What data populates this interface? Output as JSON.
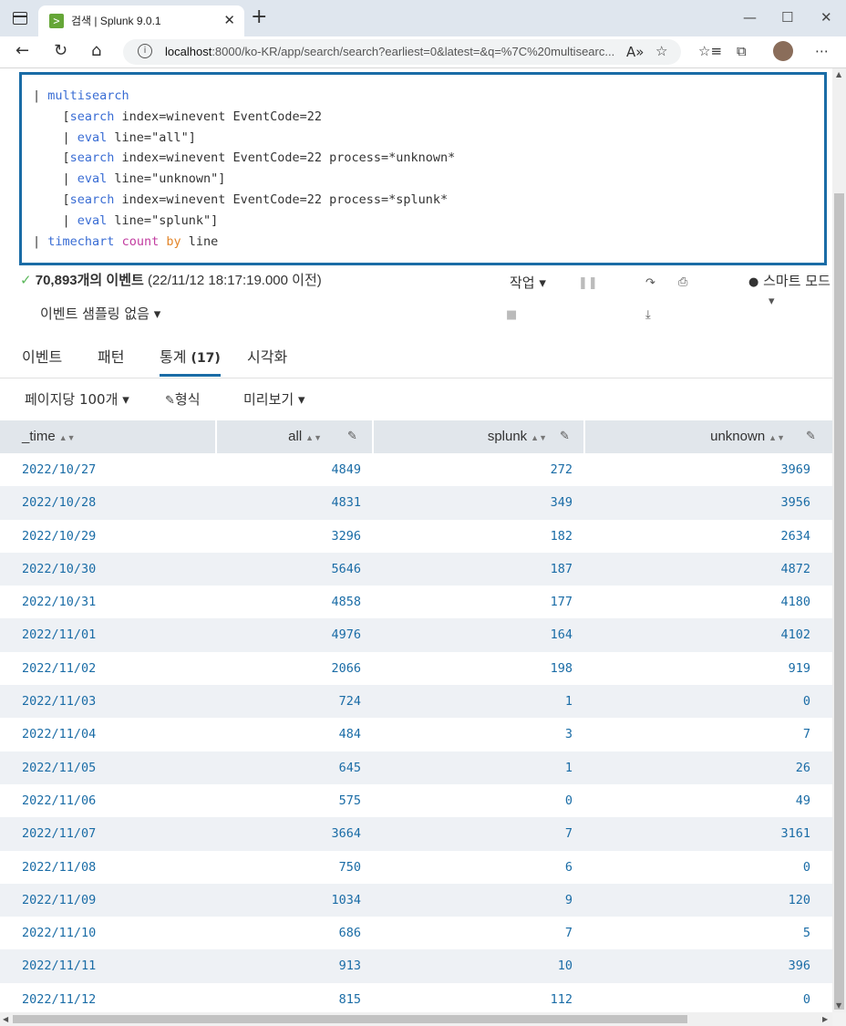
{
  "browser": {
    "tab_title": "검색 | Splunk 9.0.1",
    "url_host": "localhost",
    "url_rest": ":8000/ko-KR/app/search/search?earliest=0&latest=&q=%7C%20multisearc..."
  },
  "search": {
    "lines": [
      {
        "pre": "| ",
        "kw": "multisearch",
        "rest": ""
      },
      {
        "pre": "    [",
        "kw": "search",
        "rest": " index=winevent EventCode=22"
      },
      {
        "pre": "    | ",
        "kw": "eval",
        "rest": " line=\"all\"]"
      },
      {
        "pre": "    [",
        "kw": "search",
        "rest": " index=winevent EventCode=22 process=*unknown*"
      },
      {
        "pre": "    | ",
        "kw": "eval",
        "rest": " line=\"unknown\"]"
      },
      {
        "pre": "    [",
        "kw": "search",
        "rest": " index=winevent EventCode=22 process=*splunk*"
      },
      {
        "pre": "    | ",
        "kw": "eval",
        "rest": " line=\"splunk\"]"
      }
    ],
    "last_line": {
      "pre": "| ",
      "kw": "timechart",
      "fn": "count",
      "by": "by",
      "rest": " line"
    }
  },
  "status": {
    "count": "70,893개의 이벤트",
    "time": "(22/11/12 18:17:19.000 이전)",
    "sampling": "이벤트 샘플링 없음",
    "job": "작업",
    "smart": "스마트 모드"
  },
  "tabs": [
    {
      "label": "이벤트"
    },
    {
      "label": "패턴"
    },
    {
      "label": "통계",
      "count": "(17)"
    },
    {
      "label": "시각화"
    }
  ],
  "options": {
    "per_page": "페이지당 100개",
    "format": "형식",
    "preview": "미리보기"
  },
  "table": {
    "columns": [
      "_time",
      "all",
      "splunk",
      "unknown"
    ],
    "rows": [
      [
        "2022/10/27",
        "4849",
        "272",
        "3969"
      ],
      [
        "2022/10/28",
        "4831",
        "349",
        "3956"
      ],
      [
        "2022/10/29",
        "3296",
        "182",
        "2634"
      ],
      [
        "2022/10/30",
        "5646",
        "187",
        "4872"
      ],
      [
        "2022/10/31",
        "4858",
        "177",
        "4180"
      ],
      [
        "2022/11/01",
        "4976",
        "164",
        "4102"
      ],
      [
        "2022/11/02",
        "2066",
        "198",
        "919"
      ],
      [
        "2022/11/03",
        "724",
        "1",
        "0"
      ],
      [
        "2022/11/04",
        "484",
        "3",
        "7"
      ],
      [
        "2022/11/05",
        "645",
        "1",
        "26"
      ],
      [
        "2022/11/06",
        "575",
        "0",
        "49"
      ],
      [
        "2022/11/07",
        "3664",
        "7",
        "3161"
      ],
      [
        "2022/11/08",
        "750",
        "6",
        "0"
      ],
      [
        "2022/11/09",
        "1034",
        "9",
        "120"
      ],
      [
        "2022/11/10",
        "686",
        "7",
        "5"
      ],
      [
        "2022/11/11",
        "913",
        "10",
        "396"
      ],
      [
        "2022/11/12",
        "815",
        "112",
        "0"
      ]
    ]
  }
}
